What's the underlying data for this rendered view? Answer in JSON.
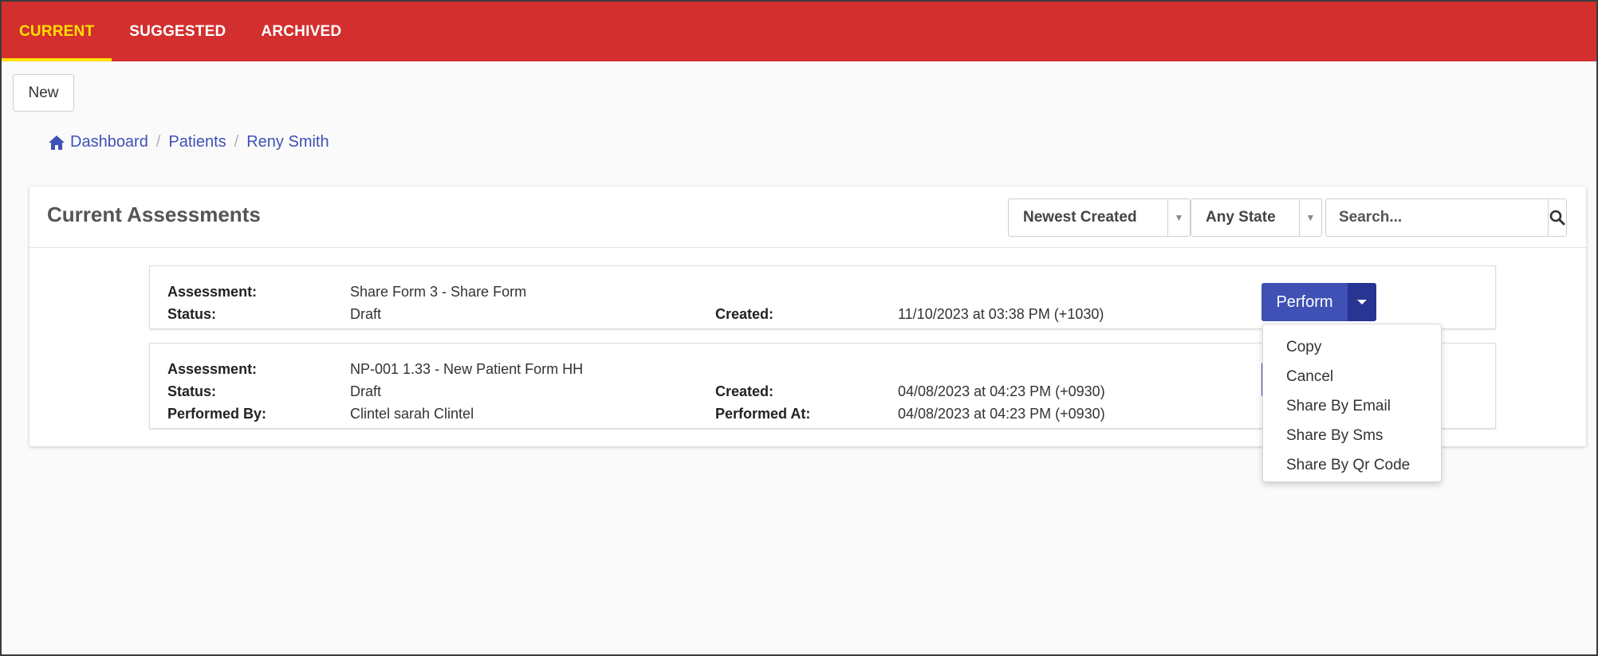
{
  "tabs": [
    {
      "label": "CURRENT",
      "active": true
    },
    {
      "label": "SUGGESTED",
      "active": false
    },
    {
      "label": "ARCHIVED",
      "active": false
    }
  ],
  "toolbar": {
    "new_label": "New"
  },
  "breadcrumb": {
    "items": [
      "Dashboard",
      "Patients",
      "Reny Smith"
    ],
    "separator": "/"
  },
  "card": {
    "title": "Current Assessments",
    "sort_select": "Newest Created",
    "state_select": "Any State",
    "search_placeholder": "Search..."
  },
  "assessments": [
    {
      "assessment_label": "Assessment:",
      "assessment_value": "Share Form 3 - Share Form",
      "status_label": "Status:",
      "status_value": "Draft",
      "created_label": "Created:",
      "created_value": "11/10/2023 at 03:38 PM (+1030)",
      "action_label": "Perform"
    },
    {
      "assessment_label": "Assessment:",
      "assessment_value": "NP-001 1.33 - New Patient Form HH",
      "status_label": "Status:",
      "status_value": "Draft",
      "created_label": "Created:",
      "created_value": "04/08/2023 at 04:23 PM (+0930)",
      "performed_by_label": "Performed By:",
      "performed_by_value": "Clintel sarah Clintel",
      "performed_at_label": "Performed At:",
      "performed_at_value": "04/08/2023 at 04:23 PM (+0930)"
    }
  ],
  "dropdown_menu": [
    "Copy",
    "Cancel",
    "Share By Email",
    "Share By Sms",
    "Share By Qr Code"
  ],
  "colors": {
    "topbar": "#d32f2f",
    "active_tab": "#ffe000",
    "primary": "#3f51b5",
    "primary_dark": "#283593",
    "link": "#3f51b5"
  },
  "icons": {
    "home": "home-icon",
    "search": "search-icon",
    "caret": "caret-down-icon"
  }
}
